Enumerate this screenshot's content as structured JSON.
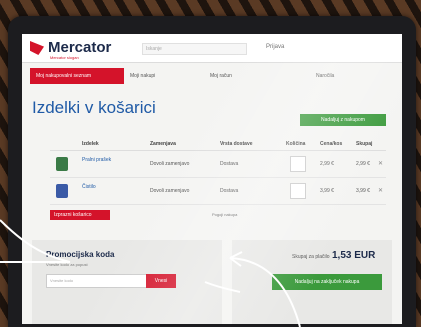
{
  "brand": {
    "name": "Mercator",
    "tagline": "Mercator slogan",
    "color": "#d4132a"
  },
  "header": {
    "search_placeholder": "Iskanje",
    "account": "Prijava"
  },
  "nav": {
    "primary": "Moj nakupovalni seznam",
    "items": [
      "Moji nakupi",
      "Moj račun",
      "Naročila"
    ]
  },
  "page": {
    "title": "Izdelki v košarici",
    "continue_button": "Nadaljuj z nakupom"
  },
  "table": {
    "headers": [
      "Izdelek",
      "Zamenjava",
      "Vrsta dostave",
      "Količina",
      "Cena/kos",
      "Skupaj"
    ],
    "rows": [
      {
        "name": "Pralni prašek",
        "swap": "Dovoli zamenjavo",
        "delivery": "Dostava",
        "price": "2,99 €",
        "total": "2,99 €"
      },
      {
        "name": "Čistilo",
        "swap": "Dovoli zamenjavo",
        "delivery": "Dostava",
        "price": "3,99 €",
        "total": "3,99 €"
      }
    ]
  },
  "actions": {
    "clear_cart": "Izprazni košarico",
    "note": "Pogoji nakupa"
  },
  "coupon": {
    "title": "Promocijska koda",
    "subtitle": "Vnesite kodo za popust",
    "placeholder": "Vnesite kodo",
    "button": "Vnesi"
  },
  "summary": {
    "total_label": "Skupaj za plačilo",
    "total_value": "1,53 EUR",
    "checkout_button": "Nadaljuj na zaključek nakupa"
  },
  "colors": {
    "accent_green": "#3b9a3c",
    "title_blue": "#1f5aa6"
  }
}
